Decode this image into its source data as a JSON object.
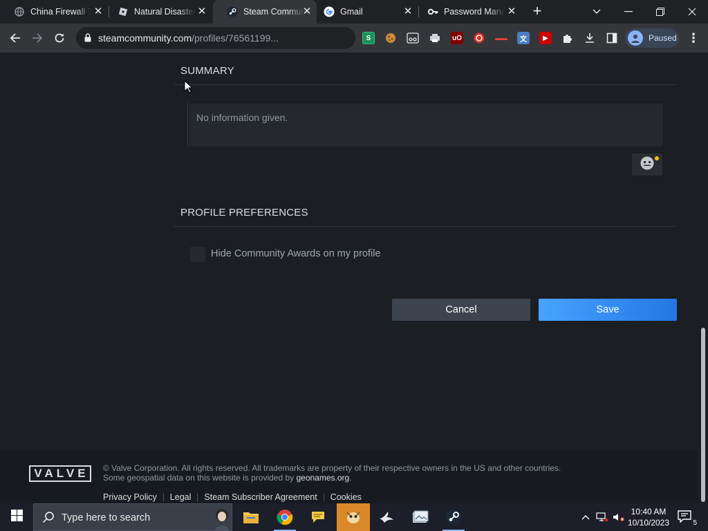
{
  "browser": {
    "tabs": [
      {
        "title": "China Firewall Te",
        "icon": "globe-icon"
      },
      {
        "title": "Natural Disaster",
        "icon": "roblox-icon"
      },
      {
        "title": "Steam Commun",
        "icon": "steam-icon",
        "active": true
      },
      {
        "title": "Gmail",
        "icon": "google-icon"
      },
      {
        "title": "Password Mana",
        "icon": "key-icon"
      }
    ],
    "url_host": "steamcommunity.com",
    "url_path": "/profiles/76561199...",
    "profile_label": "Paused"
  },
  "page": {
    "summary_title": "SUMMARY",
    "summary_text": "No information given.",
    "preferences_title": "PROFILE PREFERENCES",
    "hide_awards_label": "Hide Community Awards on my profile",
    "hide_awards_checked": false,
    "cancel_label": "Cancel",
    "save_label": "Save"
  },
  "footer": {
    "logo_text": "VALVE",
    "copyright_line1": "© Valve Corporation. All rights reserved. All trademarks are property of their respective owners in the US and other countries.",
    "copyright_line2_prefix": "Some geospatial data on this website is provided by ",
    "copyright_geo_link": "geonames.org",
    "copyright_line2_suffix": ".",
    "links": [
      "Privacy Policy",
      "Legal",
      "Steam Subscriber Agreement",
      "Cookies"
    ]
  },
  "taskbar": {
    "search_placeholder": "Type here to search",
    "time": "10:40 AM",
    "date": "10/10/2023",
    "notification_count": "5"
  },
  "colors": {
    "steam_bg": "#1b1e23",
    "save_blue": "#2477e3",
    "cancel_gray": "#3d4450"
  }
}
